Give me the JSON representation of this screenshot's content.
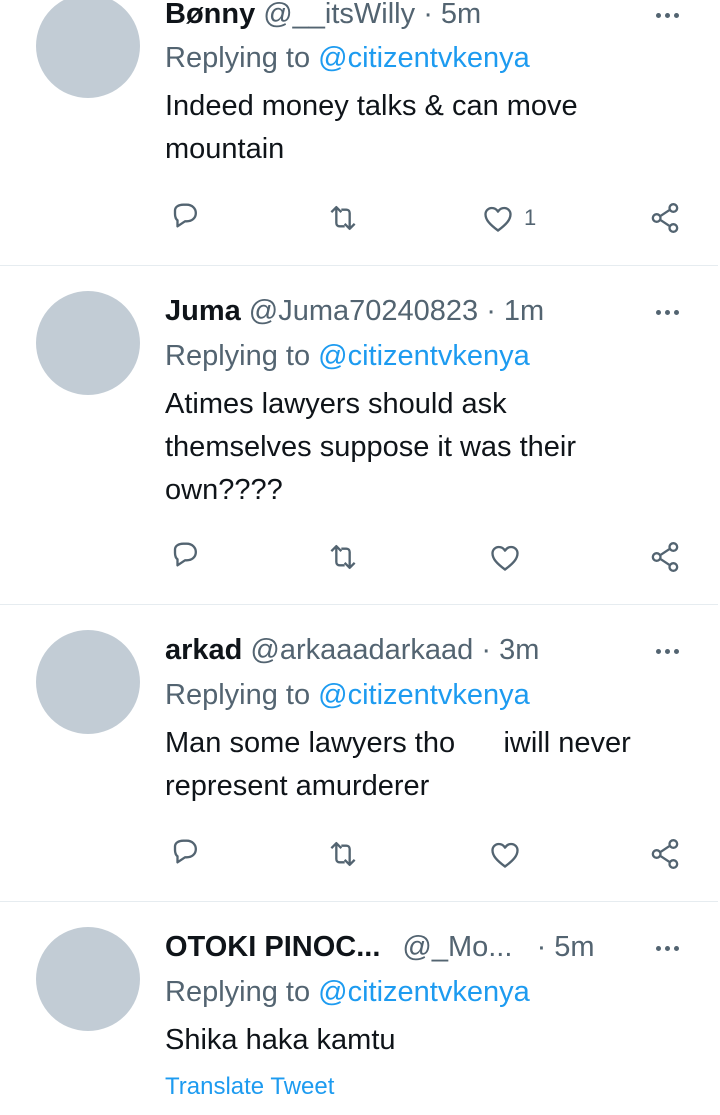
{
  "tweets": [
    {
      "name": "Bønny",
      "handle": "@__itsWilly",
      "time": "· 5m",
      "replying_prefix": "Replying to ",
      "replying_to": "@citizentvkenya",
      "text": "Indeed money talks & can move mountain",
      "like_count": "1"
    },
    {
      "name": "Juma",
      "handle": "@Juma70240823",
      "time": "· 1m",
      "replying_prefix": "Replying to ",
      "replying_to": "@citizentvkenya",
      "text": "Atimes lawyers should ask themselves suppose it was their own????",
      "like_count": ""
    },
    {
      "name": "arkad",
      "handle": "@arkaaadarkaad",
      "time": "· 3m",
      "replying_prefix": "Replying to ",
      "replying_to": "@citizentvkenya",
      "text": "Man some lawyers tho      iwill never represent amurderer",
      "like_count": ""
    },
    {
      "name": "OTOKI PINOC...",
      "handle": "@_Mo...",
      "time": "· 5m",
      "replying_prefix": "Replying to ",
      "replying_to": "@citizentvkenya",
      "text": "Shika haka kamtu",
      "translate": "Translate Tweet"
    }
  ],
  "icons": {
    "reply": "reply-icon",
    "retweet": "retweet-icon",
    "like": "heart-icon",
    "share": "share-icon",
    "more": "more-icon"
  },
  "colors": {
    "link": "#1d9bf0",
    "secondary_text": "#536471",
    "avatar_placeholder": "#c2ccd5"
  }
}
